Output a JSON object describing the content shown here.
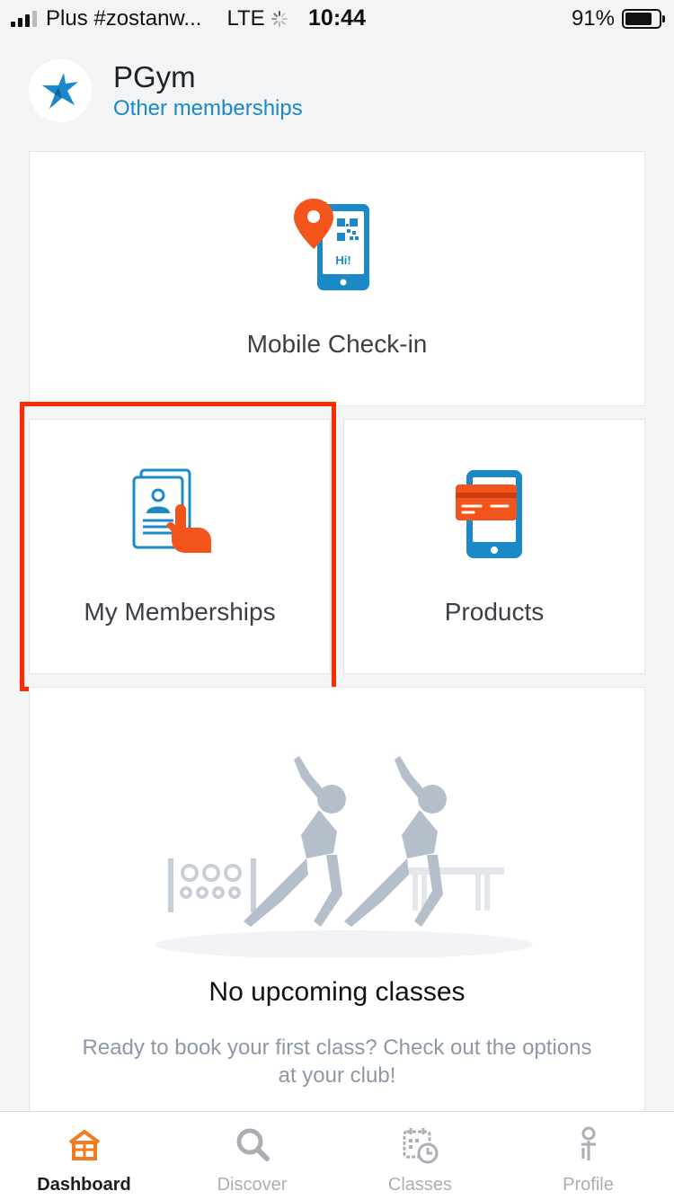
{
  "status_bar": {
    "carrier": "Plus #zostanw...",
    "network": "LTE",
    "time": "10:44",
    "battery_percent": "91%",
    "battery_level": 0.91
  },
  "header": {
    "club_name": "PGym",
    "other_memberships_link": "Other memberships"
  },
  "tiles": {
    "checkin": {
      "label": "Mobile Check-in",
      "icon": "phone-qr-checkin-icon",
      "badge": "Hi!"
    },
    "memberships": {
      "label": "My Memberships",
      "icon": "membership-card-touch-icon"
    },
    "products": {
      "label": "Products",
      "icon": "phone-credit-card-icon"
    }
  },
  "classes": {
    "title": "No upcoming classes",
    "body": "Ready to book your first class? Check out the options at your club!"
  },
  "tab_bar": {
    "tabs": [
      {
        "label": "Dashboard",
        "icon": "home-icon",
        "active": true
      },
      {
        "label": "Discover",
        "icon": "search-icon",
        "active": false
      },
      {
        "label": "Classes",
        "icon": "calendar-clock-icon",
        "active": false
      },
      {
        "label": "Profile",
        "icon": "person-icon",
        "active": false
      }
    ]
  },
  "colors": {
    "accent_blue": "#1b88c8",
    "accent_orange": "#f2541b",
    "highlight_red": "#ff2a00",
    "active_tab": "#f47a20"
  }
}
